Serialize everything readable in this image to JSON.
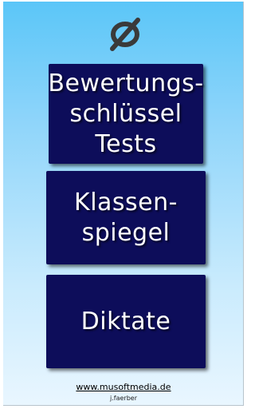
{
  "logo": {
    "icon": "empty-set-icon",
    "color": "#3a3a3a"
  },
  "menu": {
    "items": [
      {
        "label": "Bewertungs-\nschlüssel\nTests"
      },
      {
        "label": "Klassen-\nspiegel"
      },
      {
        "label": "Diktate"
      }
    ]
  },
  "footer": {
    "link": "www.musoftmedia.de",
    "author": "j.faerber"
  },
  "colors": {
    "button_bg": "#0d0d5a",
    "background_top": "#5bc6f8",
    "background_bottom": "#e9f6ff"
  }
}
